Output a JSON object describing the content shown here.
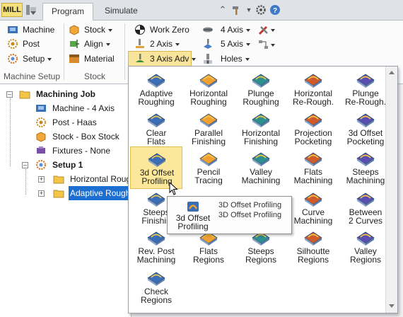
{
  "tabbar": {
    "mill_label": "MILL",
    "tabs": [
      {
        "label": "Program",
        "active": true
      },
      {
        "label": "Simulate",
        "active": false
      }
    ],
    "right_icons": [
      "collapse-ribbon-icon",
      "hammer-icon",
      "settings-icon",
      "help-icon"
    ]
  },
  "ribbon": {
    "machine_setup": {
      "group_label": "Machine Setup",
      "buttons": [
        {
          "label": "Machine",
          "icon": "machine-icon"
        },
        {
          "label": "Post",
          "icon": "post-icon"
        },
        {
          "label": "Setup",
          "icon": "setup-icon",
          "dropdown": true
        }
      ]
    },
    "stock": {
      "group_label": "Stock",
      "buttons": [
        {
          "label": "Stock",
          "icon": "stock-icon",
          "dropdown": true
        },
        {
          "label": "Align",
          "icon": "align-icon",
          "dropdown": true
        },
        {
          "label": "Material",
          "icon": "material-icon"
        }
      ]
    },
    "program": {
      "buttons": [
        {
          "label": "Work Zero",
          "icon": "work-zero-icon"
        },
        {
          "label": "2 Axis",
          "icon": "2-axis-icon",
          "dropdown": true
        },
        {
          "label": "3 Axis Adv",
          "icon": "3-axis-adv-icon",
          "dropdown": true,
          "pressed": true
        },
        {
          "label": "4 Axis",
          "icon": "4-axis-icon",
          "dropdown": true
        },
        {
          "label": "5 Axis",
          "icon": "5-axis-icon",
          "dropdown": true
        },
        {
          "label": "Holes",
          "icon": "holes-icon",
          "dropdown": true
        }
      ]
    }
  },
  "tree": {
    "root": "Machining Job",
    "items": [
      {
        "label": "Machine - 4 Axis",
        "icon": "machine-icon"
      },
      {
        "label": "Post - Haas",
        "icon": "post-icon"
      },
      {
        "label": "Stock - Box Stock",
        "icon": "stock-icon"
      },
      {
        "label": "Fixtures - None",
        "icon": "fixtures-icon"
      }
    ],
    "setup": "Setup 1",
    "setup_children": [
      {
        "label": "Horizontal Roug",
        "selected": false
      },
      {
        "label": "Adaptive Rough",
        "selected": true
      }
    ]
  },
  "gallery": {
    "items": [
      {
        "label": "Adaptive\nRoughing",
        "icon": "adaptive-roughing-icon"
      },
      {
        "label": "Horizontal\nRoughing",
        "icon": "horizontal-roughing-icon"
      },
      {
        "label": "Plunge\nRoughing",
        "icon": "plunge-roughing-icon"
      },
      {
        "label": "Horizontal\nRe-Rough.",
        "icon": "horizontal-rerough-icon"
      },
      {
        "label": "Plunge\nRe-Rough.",
        "icon": "plunge-rerough-icon"
      },
      {
        "label": "Clear\nFlats",
        "icon": "clear-flats-icon"
      },
      {
        "label": "Parallel\nFinishing",
        "icon": "parallel-finishing-icon"
      },
      {
        "label": "Horizontal\nFinishing",
        "icon": "horizontal-finishing-icon"
      },
      {
        "label": "Projection\nPocketing",
        "icon": "projection-pocketing-icon"
      },
      {
        "label": "3d Offset\nPocketing",
        "icon": "3d-offset-pocketing-icon"
      },
      {
        "label": "3d Offset\nProfiling",
        "icon": "3d-offset-profiling-icon",
        "highlighted": true
      },
      {
        "label": "Pencil\nTracing",
        "icon": "pencil-tracing-icon"
      },
      {
        "label": "Valley\nMachining",
        "icon": "valley-machining-icon"
      },
      {
        "label": "Flats\nMachining",
        "icon": "flats-machining-icon"
      },
      {
        "label": "Steeps\nMachining",
        "icon": "steeps-machining-icon"
      },
      {
        "label": "Steeps\nFinishin",
        "icon": "steeps-finishing-icon"
      },
      {
        "label": "",
        "icon": "hidden-item-icon"
      },
      {
        "label": "",
        "icon": "hidden-item-icon"
      },
      {
        "label": "Curve\nMachining",
        "icon": "curve-machining-icon"
      },
      {
        "label": "Between\n2 Curves",
        "icon": "between-2-curves-icon"
      },
      {
        "label": "Rev. Post\nMachining",
        "icon": "rev-post-machining-icon"
      },
      {
        "label": "Flats\nRegions",
        "icon": "flats-regions-icon"
      },
      {
        "label": "Steeps\nRegions",
        "icon": "steeps-regions-icon"
      },
      {
        "label": "Silhoutte\nRegions",
        "icon": "silhoutte-regions-icon"
      },
      {
        "label": "Valley\nRegions",
        "icon": "valley-regions-icon"
      },
      {
        "label": "Check\nRegions",
        "icon": "check-regions-icon"
      }
    ]
  },
  "tooltip": {
    "icon_label": "3d Offset\nProfiling",
    "title": "3D Offset Profiling",
    "description": "3D Offset Profiling"
  },
  "colors": {
    "selection": "#1c6fd0",
    "highlight": "#fde79a",
    "ribbon_pressed": "#f8e49a",
    "op_orange": "#f0a030",
    "op_blue": "#3a6fb8"
  }
}
